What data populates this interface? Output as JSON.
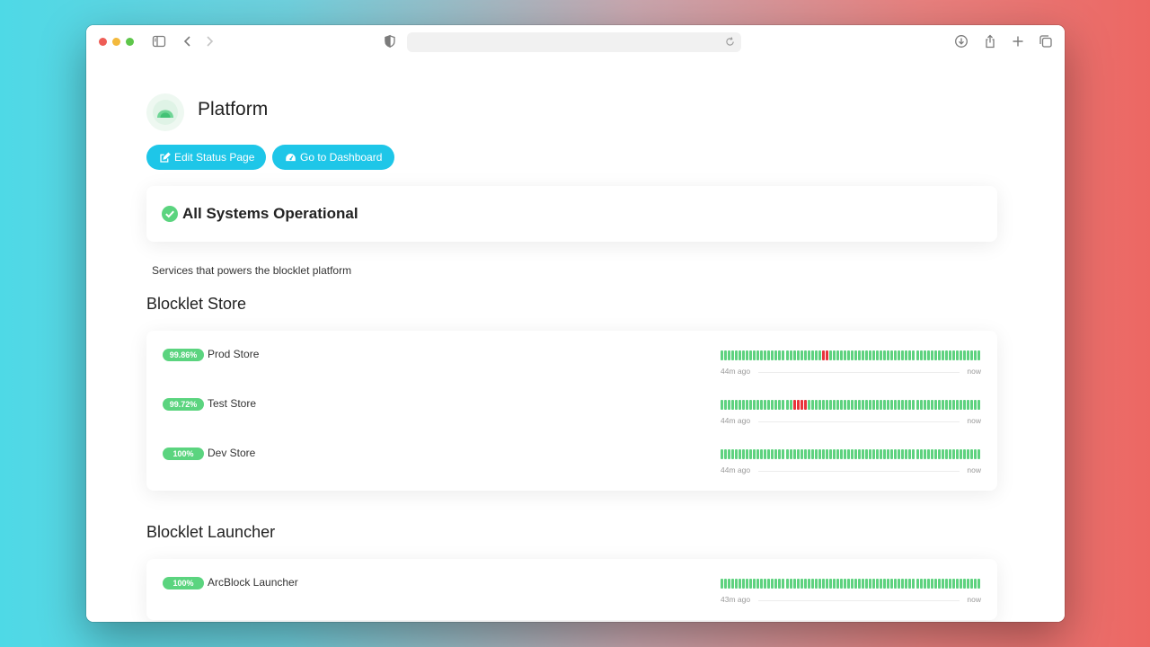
{
  "browser": {
    "url": "",
    "icons": [
      "sidebar-icon",
      "back-icon",
      "forward-icon",
      "shield-icon",
      "reload-icon",
      "download-icon",
      "share-icon",
      "new-tab-icon",
      "tabs-overview-icon"
    ]
  },
  "page": {
    "title": "Platform",
    "logo": "dome-logo"
  },
  "actions": {
    "edit_label": "Edit Status Page",
    "dashboard_label": "Go to Dashboard"
  },
  "status": {
    "text": "All Systems Operational",
    "icon": "check-circle-icon",
    "color": "#5bd47f"
  },
  "description": "Services that powers the blocklet platform",
  "colors": {
    "accent": "#1ec6e8",
    "up": "#5ed27f",
    "down": "#e8333b",
    "badge": "#5bd47f"
  },
  "groups": [
    {
      "title": "Blocklet Store",
      "services": [
        {
          "uptime": "99.86%",
          "name": "Prod Store",
          "start": "44m ago",
          "end": "now",
          "history": [
            1,
            1,
            1,
            1,
            1,
            1,
            1,
            1,
            1,
            1,
            1,
            1,
            1,
            1,
            1,
            1,
            1,
            1,
            1,
            1,
            1,
            1,
            1,
            1,
            1,
            1,
            1,
            1,
            0,
            0,
            1,
            1,
            1,
            1,
            1,
            1,
            1,
            1,
            1,
            1,
            1,
            1,
            1,
            1,
            1,
            1,
            1,
            1,
            1,
            1,
            1,
            1,
            1,
            1,
            1,
            1,
            1,
            1,
            1,
            1,
            1,
            1,
            1,
            1,
            1,
            1,
            1,
            1,
            1,
            1,
            1,
            1
          ]
        },
        {
          "uptime": "99.72%",
          "name": "Test Store",
          "start": "44m ago",
          "end": "now",
          "history": [
            1,
            1,
            1,
            1,
            1,
            1,
            1,
            1,
            1,
            1,
            1,
            1,
            1,
            1,
            1,
            1,
            1,
            1,
            1,
            1,
            0,
            0,
            0,
            0,
            1,
            1,
            1,
            1,
            1,
            1,
            1,
            1,
            1,
            1,
            1,
            1,
            1,
            1,
            1,
            1,
            1,
            1,
            1,
            1,
            1,
            1,
            1,
            1,
            1,
            1,
            1,
            1,
            1,
            1,
            1,
            1,
            1,
            1,
            1,
            1,
            1,
            1,
            1,
            1,
            1,
            1,
            1,
            1,
            1,
            1,
            1,
            1
          ]
        },
        {
          "uptime": "100%",
          "name": "Dev Store",
          "start": "44m ago",
          "end": "now",
          "history": [
            1,
            1,
            1,
            1,
            1,
            1,
            1,
            1,
            1,
            1,
            1,
            1,
            1,
            1,
            1,
            1,
            1,
            1,
            1,
            1,
            1,
            1,
            1,
            1,
            1,
            1,
            1,
            1,
            1,
            1,
            1,
            1,
            1,
            1,
            1,
            1,
            1,
            1,
            1,
            1,
            1,
            1,
            1,
            1,
            1,
            1,
            1,
            1,
            1,
            1,
            1,
            1,
            1,
            1,
            1,
            1,
            1,
            1,
            1,
            1,
            1,
            1,
            1,
            1,
            1,
            1,
            1,
            1,
            1,
            1,
            1,
            1
          ]
        }
      ]
    },
    {
      "title": "Blocklet Launcher",
      "services": [
        {
          "uptime": "100%",
          "name": "ArcBlock Launcher",
          "start": "43m ago",
          "end": "now",
          "history": [
            1,
            1,
            1,
            1,
            1,
            1,
            1,
            1,
            1,
            1,
            1,
            1,
            1,
            1,
            1,
            1,
            1,
            1,
            1,
            1,
            1,
            1,
            1,
            1,
            1,
            1,
            1,
            1,
            1,
            1,
            1,
            1,
            1,
            1,
            1,
            1,
            1,
            1,
            1,
            1,
            1,
            1,
            1,
            1,
            1,
            1,
            1,
            1,
            1,
            1,
            1,
            1,
            1,
            1,
            1,
            1,
            1,
            1,
            1,
            1,
            1,
            1,
            1,
            1,
            1,
            1,
            1,
            1,
            1,
            1,
            1,
            1
          ]
        }
      ]
    }
  ]
}
